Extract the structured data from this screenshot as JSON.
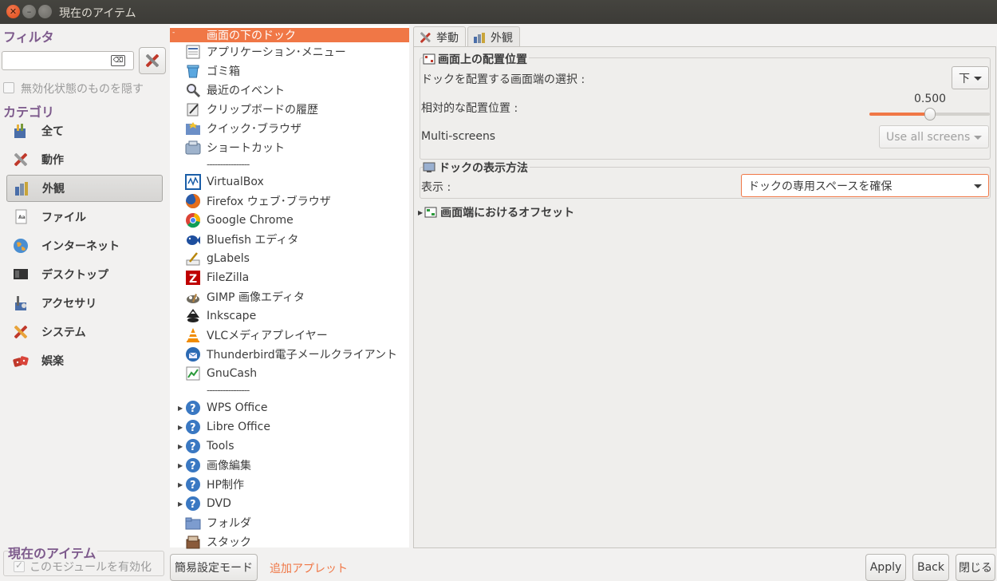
{
  "window": {
    "title": "現在のアイテム"
  },
  "filter": {
    "title": "フィルタ",
    "search_value": "",
    "hide_disabled_label": "無効化状態のものを隠す"
  },
  "categories": {
    "title": "カテゴリ",
    "items": [
      {
        "label": "全て",
        "icon": "all-icon"
      },
      {
        "label": "動作",
        "icon": "behavior-icon"
      },
      {
        "label": "外観",
        "icon": "appearance-icon",
        "selected": true
      },
      {
        "label": "ファイル",
        "icon": "files-icon"
      },
      {
        "label": "インターネット",
        "icon": "internet-icon"
      },
      {
        "label": "デスクトップ",
        "icon": "desktop-icon"
      },
      {
        "label": "アクセサリ",
        "icon": "accessories-icon"
      },
      {
        "label": "システム",
        "icon": "system-icon"
      },
      {
        "label": "娯楽",
        "icon": "fun-icon"
      }
    ]
  },
  "current_items": {
    "title": "現在のアイテム",
    "enable_module_label": "このモジュールを有効化"
  },
  "items": [
    {
      "label": "画面の下のドック",
      "selected": true
    },
    {
      "label": "アプリケーション･メニュー"
    },
    {
      "label": "ゴミ箱"
    },
    {
      "label": "最近のイベント"
    },
    {
      "label": "クリップボードの履歴"
    },
    {
      "label": "クイック･ブラウザ"
    },
    {
      "label": "ショートカット"
    },
    {
      "label": "----------------"
    },
    {
      "label": "VirtualBox"
    },
    {
      "label": "Firefox ウェブ･ブラウザ"
    },
    {
      "label": "Google Chrome"
    },
    {
      "label": "Bluefish エディタ"
    },
    {
      "label": "gLabels"
    },
    {
      "label": "FileZilla"
    },
    {
      "label": "GIMP 画像エディタ"
    },
    {
      "label": "Inkscape"
    },
    {
      "label": "VLCメディアプレイヤー"
    },
    {
      "label": "Thunderbird電子メールクライアント"
    },
    {
      "label": "GnuCash"
    },
    {
      "label": "----------------"
    },
    {
      "label": "WPS Office"
    },
    {
      "label": "Libre Office"
    },
    {
      "label": "Tools"
    },
    {
      "label": "画像編集"
    },
    {
      "label": "HP制作"
    },
    {
      "label": "DVD"
    },
    {
      "label": "フォルダ"
    },
    {
      "label": "スタック"
    }
  ],
  "tabs": [
    {
      "label": "挙動",
      "icon": "behavior-icon",
      "active": true
    },
    {
      "label": "外観",
      "icon": "appearance-icon"
    }
  ],
  "position_frame": {
    "title": "画面上の配置位置",
    "edge_label": "ドックを配置する画面端の選択 :",
    "edge_value": "下",
    "relative_label": "相対的な配置位置 :",
    "relative_value": "0.500",
    "relative_fraction": 0.5,
    "multiscreen_label": "Multi-screens",
    "multiscreen_value": "Use all screens"
  },
  "display_frame": {
    "title": "ドックの表示方法",
    "display_label": "表示 :",
    "display_value": "ドックの専用スペースを確保"
  },
  "offset_frame": {
    "title": "画面端におけるオフセット"
  },
  "bottom": {
    "simple_mode": "簡易設定モード",
    "add_applet": "追加アプレット",
    "apply": "Apply",
    "back": "Back",
    "close": "閉じる"
  },
  "colors": {
    "accent": "#f07746",
    "category_title": "#7d5a8c"
  }
}
